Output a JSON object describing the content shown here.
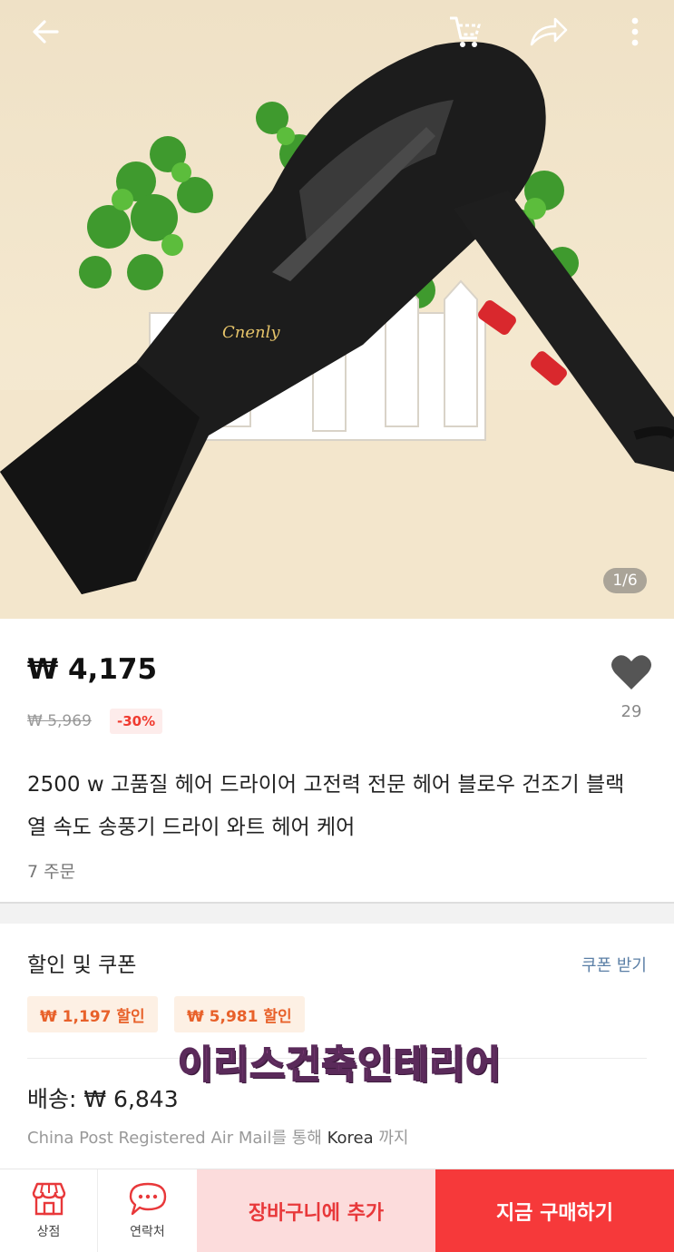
{
  "image": {
    "pager": "1/6"
  },
  "product": {
    "price": "₩ 4,175",
    "original_price": "₩ 5,969",
    "discount": "-30%",
    "wishlist_count": "29",
    "title": "2500 w 고품질 헤어 드라이어 고전력 전문 헤어 블로우 건조기 블랙 열 속도 송풍기 드라이 와트 헤어 케어",
    "orders": "7 주문"
  },
  "coupons": {
    "section_title": "할인 및 쿠폰",
    "get_link": "쿠폰 받기",
    "items": [
      "₩ 1,197 할인",
      "₩ 5,981 할인"
    ]
  },
  "watermark": "이리스건축인테리어",
  "shipping": {
    "label": "배송: ₩ 6,843",
    "method": "China Post Registered Air Mail를 통해",
    "destination": "Korea",
    "suffix": "까지"
  },
  "bottom_bar": {
    "store": "상점",
    "contact": "연락처",
    "add_to_cart": "장바구니에 추가",
    "buy_now": "지금 구매하기"
  },
  "colors": {
    "accent": "#f6393a",
    "cart_bg": "#fcdcdc",
    "coupon_text": "#e8612a",
    "link": "#5b7fa6"
  },
  "icons": [
    "back-arrow-icon",
    "cart-icon",
    "share-icon",
    "more-icon",
    "heart-icon",
    "store-icon",
    "chat-icon"
  ]
}
